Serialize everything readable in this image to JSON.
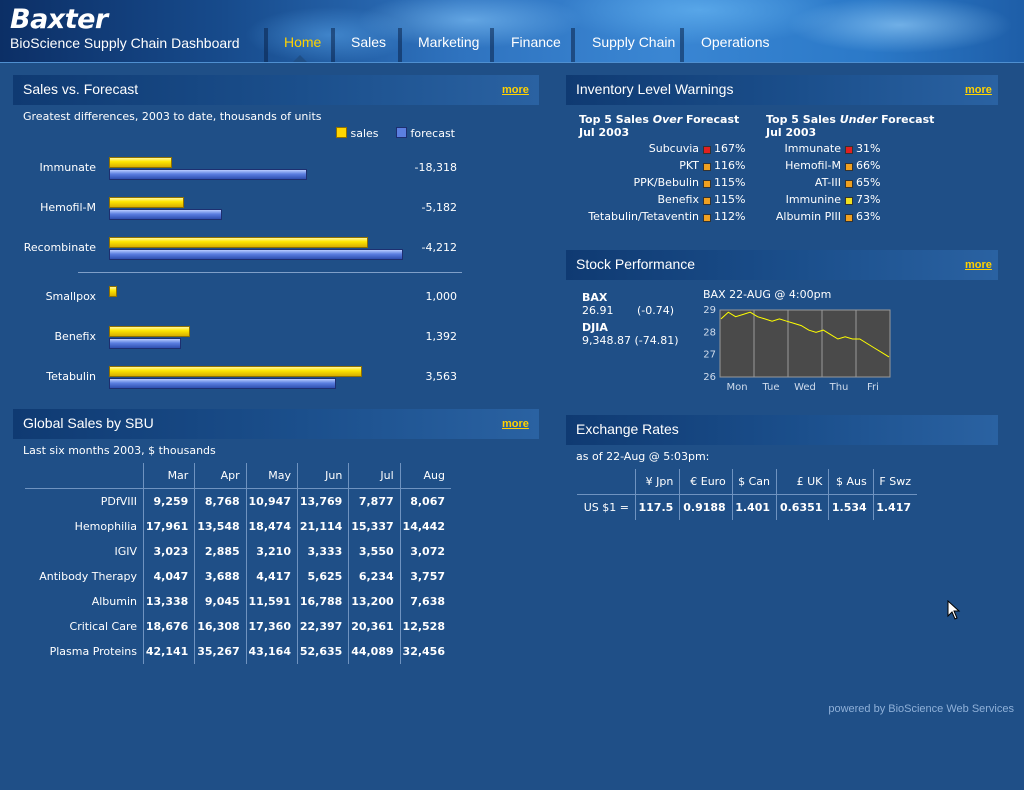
{
  "header": {
    "logo": "Baxter",
    "subtitle": "BioScience Supply Chain Dashboard",
    "nav": [
      {
        "label": "Home",
        "active": true
      },
      {
        "label": "Sales",
        "active": false
      },
      {
        "label": "Marketing",
        "active": false
      },
      {
        "label": "Finance",
        "active": false
      },
      {
        "label": "Supply Chain",
        "active": false
      },
      {
        "label": "Operations",
        "active": false
      }
    ]
  },
  "sales_forecast": {
    "title": "Sales vs. Forecast",
    "more": "more",
    "subtitle": "Greatest differences, 2003 to date, thousands of units",
    "legend": {
      "sales": "sales",
      "forecast": "forecast"
    },
    "colors": {
      "sales": "#ffd600",
      "forecast": "#5b7fe0"
    }
  },
  "chart_data": {
    "type": "bar",
    "orientation": "horizontal",
    "categories": [
      "Immunate",
      "Hemofil-M",
      "Recombinate",
      "Smallpox",
      "Benefix",
      "Tetabulin"
    ],
    "series": [
      {
        "name": "sales",
        "values": [
          21,
          25,
          88,
          2,
          27,
          86
        ]
      },
      {
        "name": "forecast",
        "values": [
          67,
          38,
          100,
          0,
          24,
          77
        ]
      }
    ],
    "difference_labels": [
      "-18,318",
      "-5,182",
      "-4,212",
      "1,000",
      "1,392",
      "3,563"
    ],
    "legend_position": "top-right",
    "grid": false
  },
  "inventory": {
    "title": "Inventory Level Warnings",
    "more": "more",
    "over_title_pre": "Top 5 Sales ",
    "over_title_em": "Over",
    "over_title_post": " Forecast",
    "over_title_month": "Jul 2003",
    "under_title_pre": "Top 5 Sales ",
    "under_title_em": "Under",
    "under_title_post": " Forecast",
    "under_title_month": "Jul 2003",
    "over": [
      {
        "name": "Subcuvia",
        "pct": "167%",
        "color": "#e02020"
      },
      {
        "name": "PKT",
        "pct": "116%",
        "color": "#f0a020"
      },
      {
        "name": "PPK/Bebulin",
        "pct": "115%",
        "color": "#f0a020"
      },
      {
        "name": "Benefix",
        "pct": "115%",
        "color": "#f0a020"
      },
      {
        "name": "Tetabulin/Tetaventin",
        "pct": "112%",
        "color": "#f0a020"
      }
    ],
    "under": [
      {
        "name": "Immunate",
        "pct": "31%",
        "color": "#e02020"
      },
      {
        "name": "Hemofil-M",
        "pct": "66%",
        "color": "#f0a020"
      },
      {
        "name": "AT-III",
        "pct": "65%",
        "color": "#f0a020"
      },
      {
        "name": "Immunine",
        "pct": "73%",
        "color": "#f0e020"
      },
      {
        "name": "Albumin PIII",
        "pct": "63%",
        "color": "#f0a020"
      }
    ]
  },
  "stock": {
    "title": "Stock Performance",
    "more": "more",
    "bax_label": "BAX",
    "bax_price": "26.91",
    "bax_change": "(-0.74)",
    "djia_label": "DJIA",
    "djia_value": "9,348.87 (-74.81)",
    "chart_title": "BAX 22-AUG @ 4:00pm",
    "y_ticks": [
      "29",
      "28",
      "27",
      "26"
    ],
    "x_ticks": [
      "Mon",
      "Tue",
      "Wed",
      "Thu",
      "Fri"
    ],
    "line_color": "#ffff00",
    "prices": [
      28.6,
      28.9,
      28.7,
      28.8,
      28.9,
      28.7,
      28.6,
      28.5,
      28.6,
      28.5,
      28.4,
      28.3,
      28.1,
      28.0,
      28.1,
      27.9,
      27.7,
      27.8,
      27.7,
      27.7,
      27.5,
      27.3,
      27.1,
      26.9
    ]
  },
  "global_sales": {
    "title": "Global Sales by SBU",
    "more": "more",
    "subtitle": "Last six months 2003, $ thousands",
    "columns": [
      "Mar",
      "Apr",
      "May",
      "Jun",
      "Jul",
      "Aug"
    ],
    "rows": [
      {
        "label": "PDfVIII",
        "values": [
          "9,259",
          "8,768",
          "10,947",
          "13,769",
          "7,877",
          "8,067"
        ]
      },
      {
        "label": "Hemophilia",
        "values": [
          "17,961",
          "13,548",
          "18,474",
          "21,114",
          "15,337",
          "14,442"
        ]
      },
      {
        "label": "IGIV",
        "values": [
          "3,023",
          "2,885",
          "3,210",
          "3,333",
          "3,550",
          "3,072"
        ]
      },
      {
        "label": "Antibody Therapy",
        "values": [
          "4,047",
          "3,688",
          "4,417",
          "5,625",
          "6,234",
          "3,757"
        ]
      },
      {
        "label": "Albumin",
        "values": [
          "13,338",
          "9,045",
          "11,591",
          "16,788",
          "13,200",
          "7,638"
        ]
      },
      {
        "label": "Critical Care",
        "values": [
          "18,676",
          "16,308",
          "17,360",
          "22,397",
          "20,361",
          "12,528"
        ]
      },
      {
        "label": "Plasma Proteins",
        "values": [
          "42,141",
          "35,267",
          "43,164",
          "52,635",
          "44,089",
          "32,456"
        ]
      }
    ]
  },
  "exchange": {
    "title": "Exchange Rates",
    "subtitle": "as of 22-Aug @ 5:03pm:",
    "columns": [
      "¥ Jpn",
      "€ Euro",
      "$ Can",
      "£ UK",
      "$ Aus",
      "F Swz"
    ],
    "row_label": "US $1 =",
    "values": [
      "117.5",
      "0.9188",
      "1.401",
      "0.6351",
      "1.534",
      "1.417"
    ]
  },
  "footer": {
    "powered": "powered by BioScience Web Services"
  }
}
